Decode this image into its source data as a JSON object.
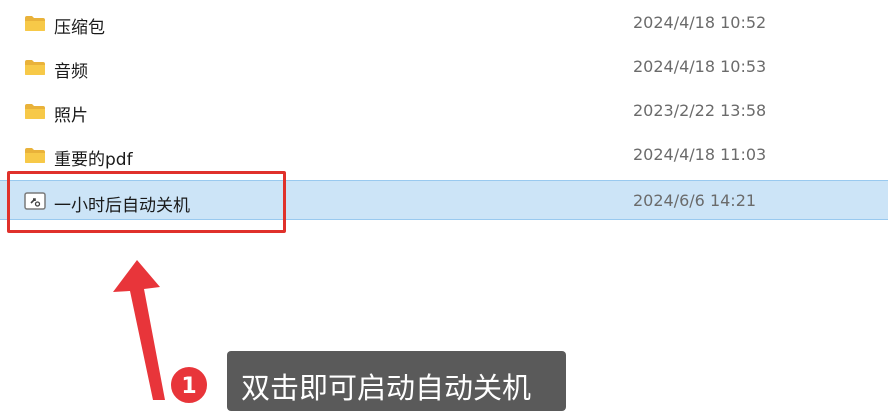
{
  "files": [
    {
      "name": "压缩包",
      "date": "2024/4/18 10:52",
      "icon": "folder-icon"
    },
    {
      "name": "音频",
      "date": "2024/4/18 10:53",
      "icon": "folder-icon"
    },
    {
      "name": "照片",
      "date": "2023/2/22 13:58",
      "icon": "folder-icon"
    },
    {
      "name": "重要的pdf",
      "date": "2024/4/18 11:03",
      "icon": "folder-icon"
    },
    {
      "name": "一小时后自动关机",
      "date": "2024/6/6 14:21",
      "icon": "shortcut-icon",
      "selected": true
    }
  ],
  "annotation": {
    "step_number": "1",
    "callout_text": "双击即可启动自动关机",
    "highlight_color": "#e0312b",
    "badge_color": "#e8353a"
  },
  "colors": {
    "selection_bg": "#cce4f7",
    "folder": "#f5c242"
  }
}
